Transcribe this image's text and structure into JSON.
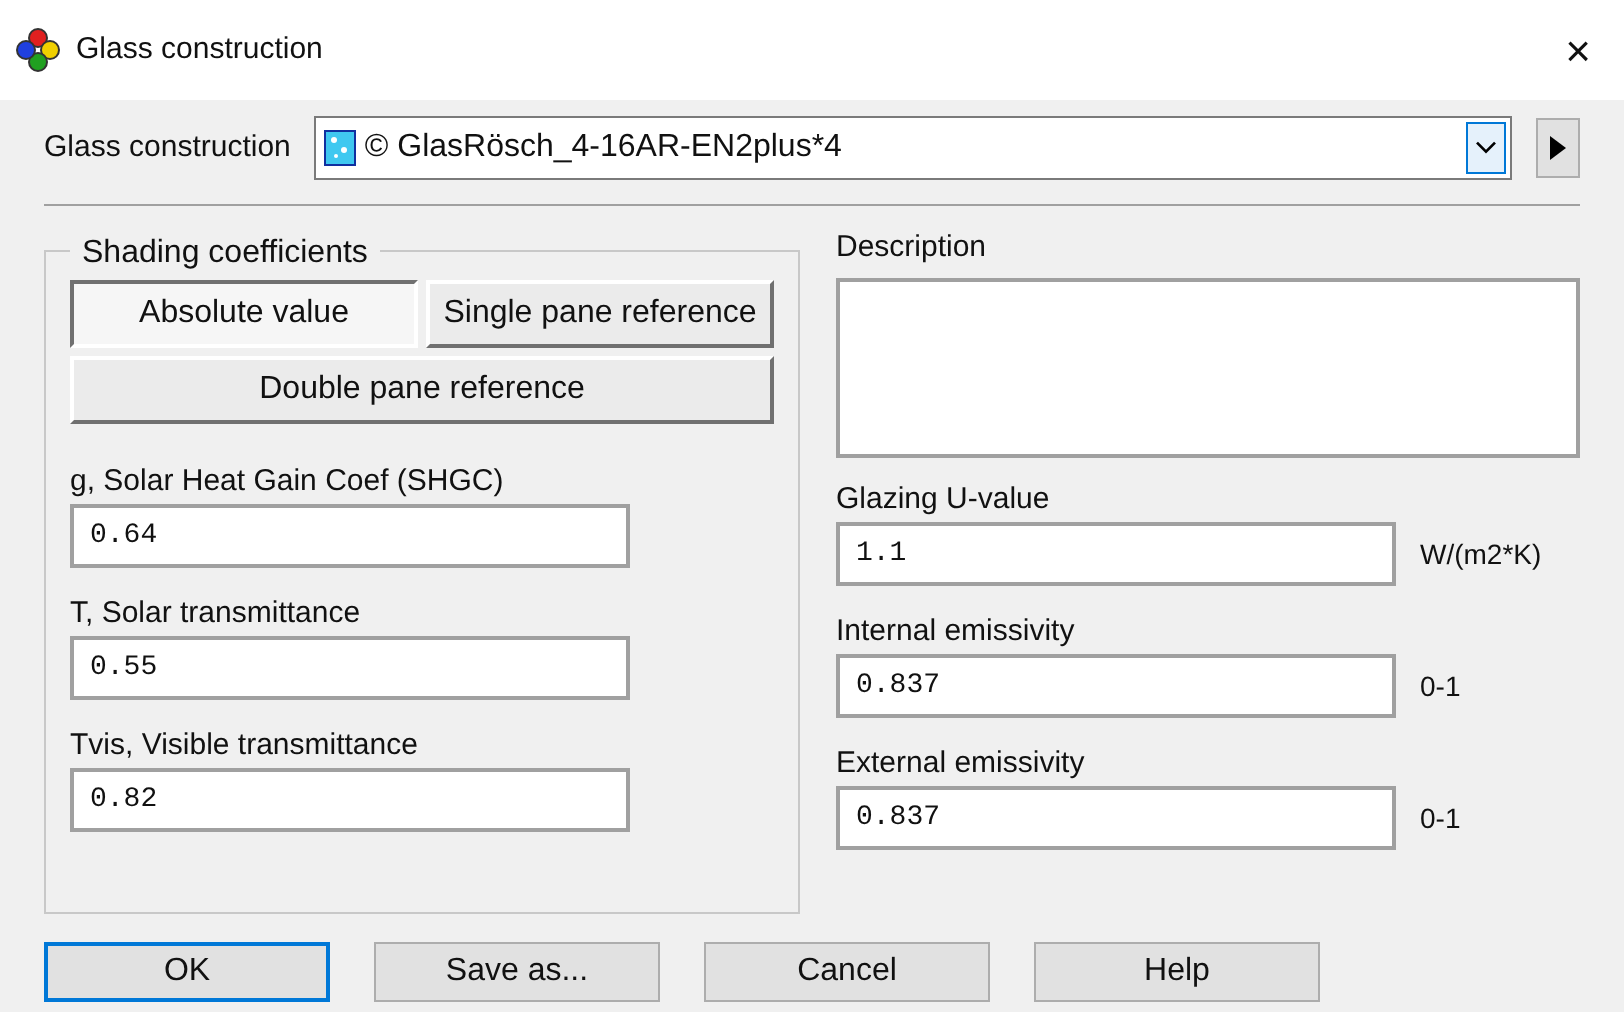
{
  "window": {
    "title": "Glass construction",
    "close": "×"
  },
  "construction": {
    "label": "Glass construction",
    "value": "© GlasRösch_4-16AR-EN2plus*4"
  },
  "shading": {
    "legend": "Shading coefficients",
    "modes": [
      {
        "label": "Absolute value",
        "selected": true
      },
      {
        "label": "Single pane reference",
        "selected": false
      },
      {
        "label": "Double pane reference",
        "selected": false
      }
    ],
    "fields": [
      {
        "label": "g, Solar Heat Gain Coef (SHGC)",
        "value": "0.64"
      },
      {
        "label": "T, Solar transmittance",
        "value": "0.55"
      },
      {
        "label": "Tvis, Visible transmittance",
        "value": "0.82"
      }
    ]
  },
  "description": {
    "label": "Description"
  },
  "properties": [
    {
      "label": "Glazing U-value",
      "value": "1.1",
      "unit": "W/(m2*K)"
    },
    {
      "label": "Internal emissivity",
      "value": "0.837",
      "unit": "0-1"
    },
    {
      "label": "External emissivity",
      "value": "0.837",
      "unit": "0-1"
    }
  ],
  "buttons": [
    {
      "label": "OK",
      "default": true
    },
    {
      "label": "Save as...",
      "default": false
    },
    {
      "label": "Cancel",
      "default": false
    },
    {
      "label": "Help",
      "default": false
    }
  ]
}
